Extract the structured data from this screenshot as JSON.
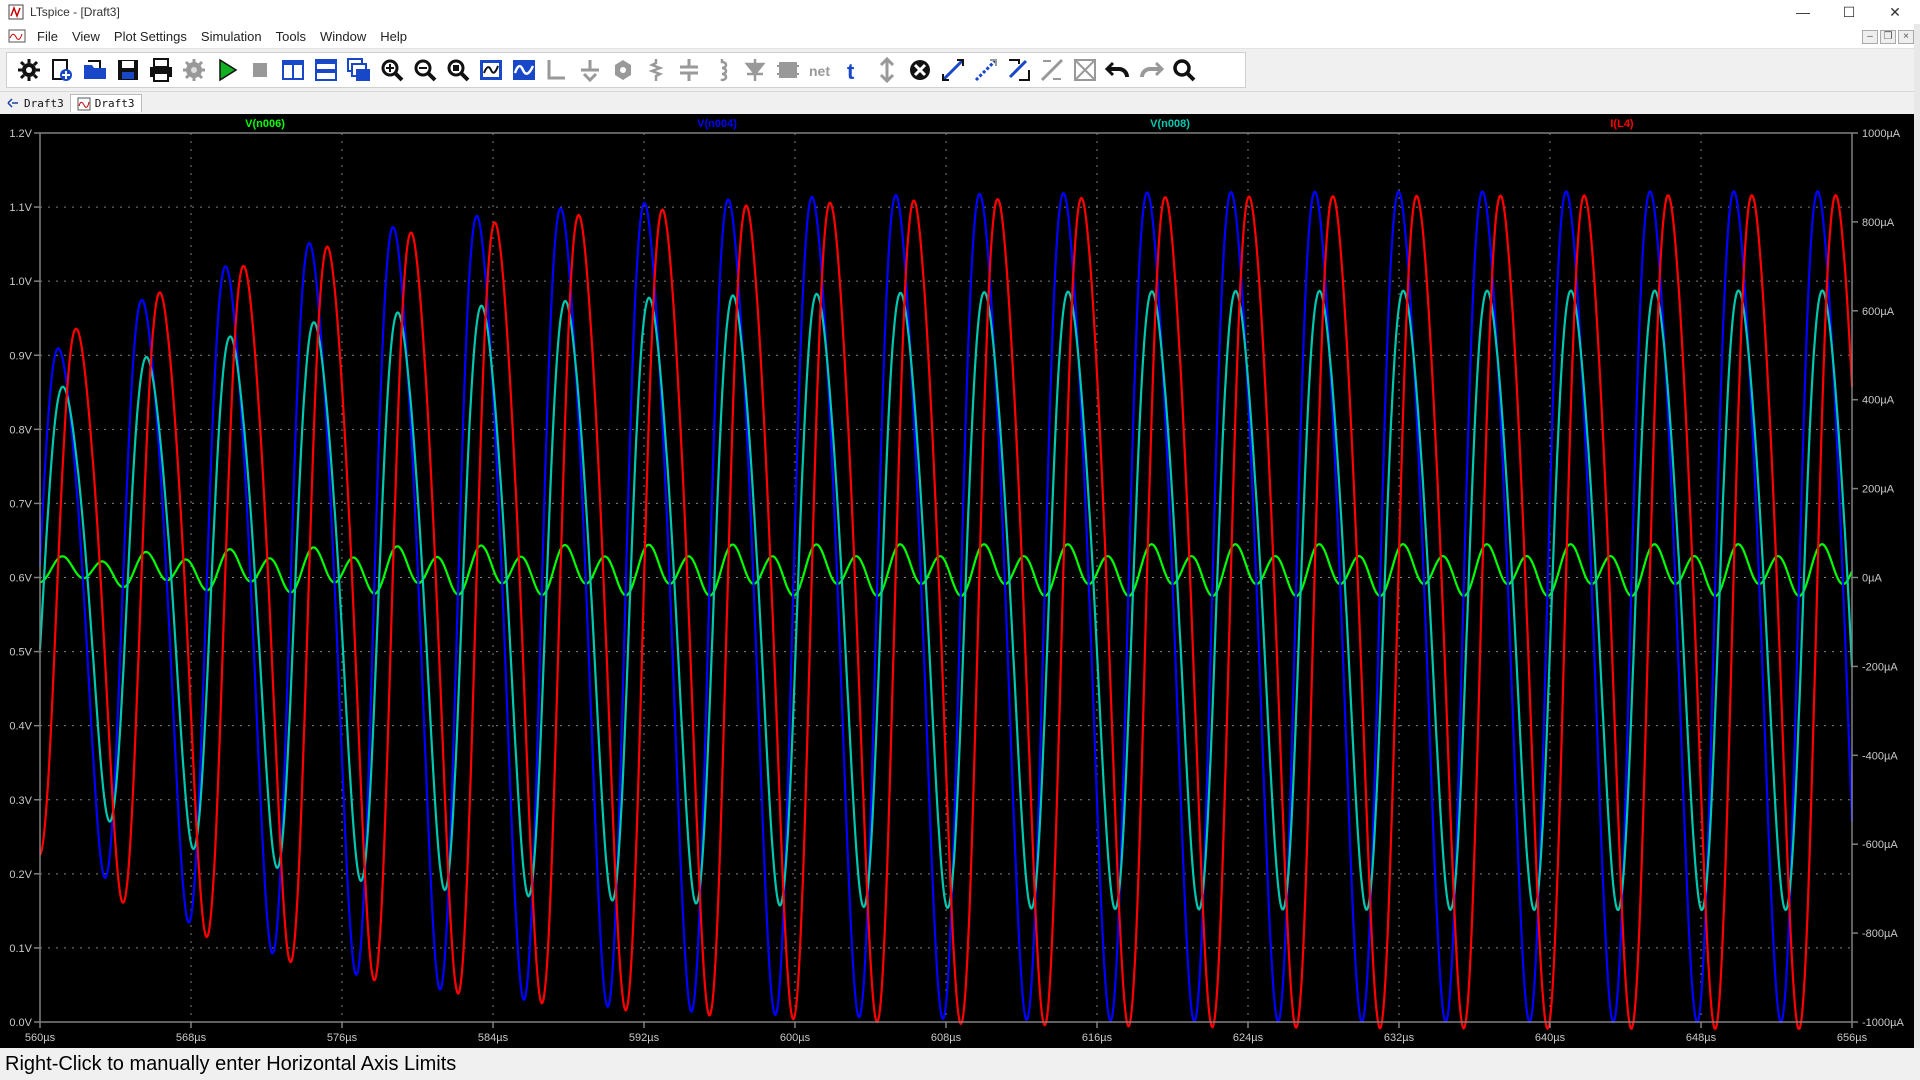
{
  "window": {
    "title": "LTspice - [Draft3]",
    "controls": [
      "minimize",
      "maximize",
      "close"
    ]
  },
  "menu": [
    "File",
    "View",
    "Plot Settings",
    "Simulation",
    "Tools",
    "Window",
    "Help"
  ],
  "toolbar": [
    "control-panel-icon",
    "new-schematic-icon",
    "open-icon",
    "save-icon",
    "print-icon",
    "setup-icon",
    "run-icon",
    "halt-icon",
    "tile-vertical-icon",
    "tile-horizontal-icon",
    "cascade-icon",
    "zoom-in-icon",
    "zoom-out-icon",
    "zoom-fit-icon",
    "autorange-icon",
    "waveform-icon",
    "wire-icon",
    "ground-icon",
    "label-net-icon",
    "resistor-icon",
    "capacitor-icon",
    "inductor-icon",
    "diode-icon",
    "component-icon",
    "spice-directive-icon",
    "text-icon",
    "move-icon",
    "delete-icon",
    "drag-icon",
    "duplicate-icon",
    "rotate-icon",
    "mirror-icon",
    "draw-icon",
    "undo-icon",
    "redo-icon",
    "find-icon"
  ],
  "tabs": [
    {
      "label": "Draft3",
      "kind": "schematic",
      "active": false
    },
    {
      "label": "Draft3",
      "kind": "waveform",
      "active": true
    }
  ],
  "status": "Right-Click to manually enter Horizontal Axis Limits",
  "colors": {
    "v006": "#00ff00",
    "v004": "#0000ff",
    "v008": "#00c8b0",
    "il4": "#ff0000",
    "grid": "#808080",
    "axis_text": "#c8c8c8",
    "plot_bg": "#000000"
  },
  "chart_data": {
    "type": "line",
    "xlabel": "",
    "x_ticks": [
      "560µs",
      "568µs",
      "576µs",
      "584µs",
      "592µs",
      "600µs",
      "608µs",
      "616µs",
      "624µs",
      "632µs",
      "640µs",
      "648µs",
      "656µs"
    ],
    "xlim": [
      560,
      656
    ],
    "left_ticks": [
      "0.0V",
      "0.1V",
      "0.2V",
      "0.3V",
      "0.4V",
      "0.5V",
      "0.6V",
      "0.7V",
      "0.8V",
      "0.9V",
      "1.0V",
      "1.1V",
      "1.2V"
    ],
    "ylim_left": [
      0.0,
      1.2
    ],
    "right_ticks": [
      "-1000µA",
      "-800µA",
      "-600µA",
      "-400µA",
      "-200µA",
      "0µA",
      "200µA",
      "400µA",
      "600µA",
      "800µA",
      "1000µA"
    ],
    "ylim_right": [
      -1000,
      1000
    ],
    "period_us": 4.44,
    "series": [
      {
        "name": "V(n006)",
        "color": "#00ff00",
        "axis": "left",
        "kind": "small",
        "amp_start": 0.018,
        "amp_end": 0.038,
        "offset": 0.61,
        "phase": -0.8,
        "settle": 10
      },
      {
        "name": "V(n004)",
        "color": "#0000ff",
        "axis": "left",
        "kind": "main",
        "amp_start": 0.31,
        "amp_end": 0.55,
        "offset": 0.595,
        "phase": 0.0,
        "settle": 12
      },
      {
        "name": "V(n008)",
        "color": "#00c8b0",
        "axis": "left",
        "kind": "main",
        "amp_start": 0.26,
        "amp_end": 0.41,
        "offset": 0.595,
        "phase": -0.35,
        "settle": 12
      },
      {
        "name": "I(L4)",
        "color": "#ff0000",
        "axis": "right",
        "kind": "main",
        "amp_start": 560,
        "amp_end": 920,
        "offset": -20,
        "phase": -1.35,
        "settle": 14
      }
    ]
  }
}
